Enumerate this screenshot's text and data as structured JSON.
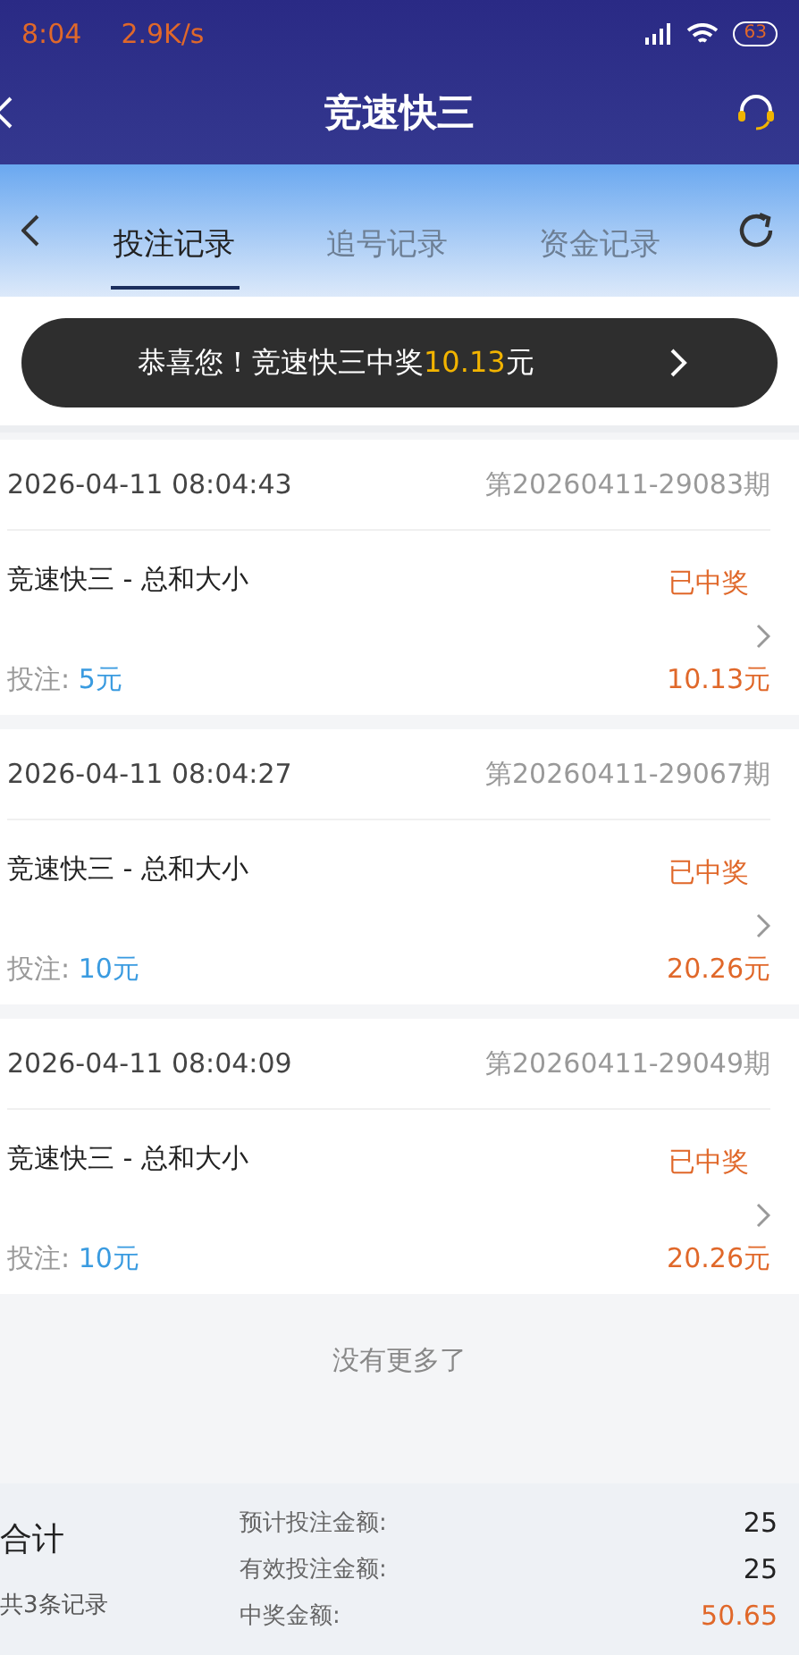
{
  "status_bar": {
    "time": "8:04",
    "speed": "2.9K/s",
    "battery": "63"
  },
  "header": {
    "title": "竞速快三"
  },
  "tabs": [
    {
      "label": "投注记录",
      "selected": true
    },
    {
      "label": "追号记录",
      "selected": false
    },
    {
      "label": "资金记录",
      "selected": false
    }
  ],
  "toast": {
    "message": "恭喜您！竞速快三中奖",
    "amount": "10.13",
    "unit": "元"
  },
  "records": [
    {
      "datetime": "2026-04-11 08:04:43",
      "issue": "第20260411-29083期",
      "game": "竞速快三 - 总和大小",
      "status": "已中奖",
      "bet_label": "投注:",
      "bet": "5元",
      "prize": "10.13元"
    },
    {
      "datetime": "2026-04-11 08:04:27",
      "issue": "第20260411-29067期",
      "game": "竞速快三 - 总和大小",
      "status": "已中奖",
      "bet_label": "投注:",
      "bet": "10元",
      "prize": "20.26元"
    },
    {
      "datetime": "2026-04-11 08:04:09",
      "issue": "第20260411-29049期",
      "game": "竞速快三 - 总和大小",
      "status": "已中奖",
      "bet_label": "投注:",
      "bet": "10元",
      "prize": "20.26元"
    }
  ],
  "end_note": "没有更多了",
  "summary": {
    "title": "合计",
    "count": "共3条记录",
    "rows": [
      {
        "label": "预计投注金额:",
        "value": "25",
        "kind": "plain"
      },
      {
        "label": "有效投注金额:",
        "value": "25",
        "kind": "plain"
      },
      {
        "label": "中奖金额:",
        "value": "50.65",
        "kind": "win"
      }
    ]
  }
}
